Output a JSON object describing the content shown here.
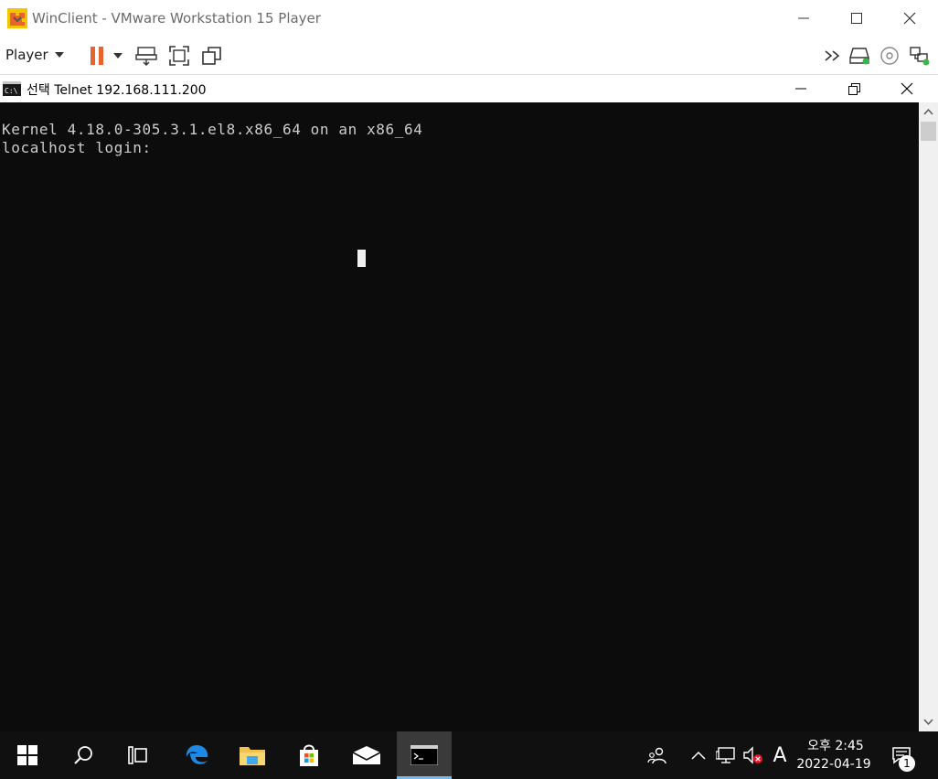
{
  "vmware": {
    "title": "WinClient - VMware Workstation 15 Player",
    "player_menu": "Player"
  },
  "telnet": {
    "title": "선택 Telnet 192.168.111.200",
    "console_lines": [
      "Kernel 4.18.0-305.3.1.el8.x86_64 on an x86_64",
      "localhost login:"
    ]
  },
  "taskbar": {
    "clock_time": "오후 2:45",
    "clock_date": "2022-04-19",
    "ime_indicator": "A",
    "notification_count": "1"
  },
  "colors": {
    "accent_orange": "#e8642c",
    "console_bg": "#0c0c0c",
    "taskbar_bg": "#101010",
    "active_underline": "#76b9ed"
  },
  "icons": [
    "vmware-logo",
    "minimize",
    "maximize",
    "close",
    "pause",
    "dropdown",
    "send-ctrl-alt-del",
    "fit-guest",
    "unity",
    "more",
    "removable-device",
    "cd-drive",
    "network",
    "cmd",
    "restore",
    "windows-start",
    "search",
    "task-view",
    "edge",
    "file-explorer",
    "store",
    "mail",
    "people",
    "chevron-up",
    "network-tray",
    "volume-muted",
    "action-center"
  ]
}
